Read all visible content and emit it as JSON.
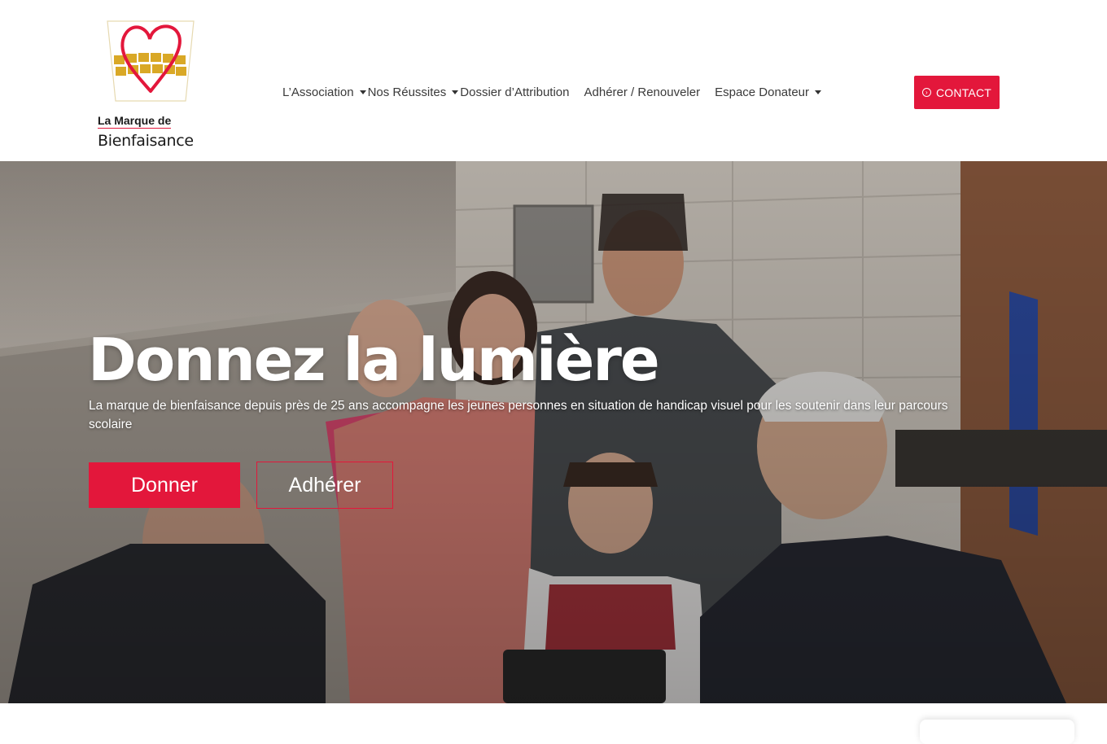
{
  "header": {
    "logo": {
      "line1": "La Marque de",
      "line2": "Bienfaisance",
      "colors": {
        "heart": "#e3173b",
        "blocks": "#d9a826"
      }
    },
    "nav": [
      {
        "label": "L’Association",
        "dropdown": true
      },
      {
        "label": "Nos Réussites",
        "dropdown": true
      },
      {
        "label": "Dossier d’Attribution",
        "dropdown": false
      },
      {
        "label": "Adhérer / Renouveler",
        "dropdown": false
      },
      {
        "label": "Espace Donateur",
        "dropdown": true
      }
    ],
    "contact": {
      "label": "CONTACT",
      "icon": "arrow-circle-right-icon"
    }
  },
  "hero": {
    "title": "Donnez la lumière",
    "subtitle": "La marque de bienfaisance depuis près de 25 ans accompagne les jeunes personnes en situation de handicap visuel pour les soutenir dans leur parcours scolaire",
    "primary_button": "Donner",
    "secondary_button": "Adhérer"
  },
  "colors": {
    "accent": "#e3173b",
    "nav_text": "#3a3a3a"
  }
}
